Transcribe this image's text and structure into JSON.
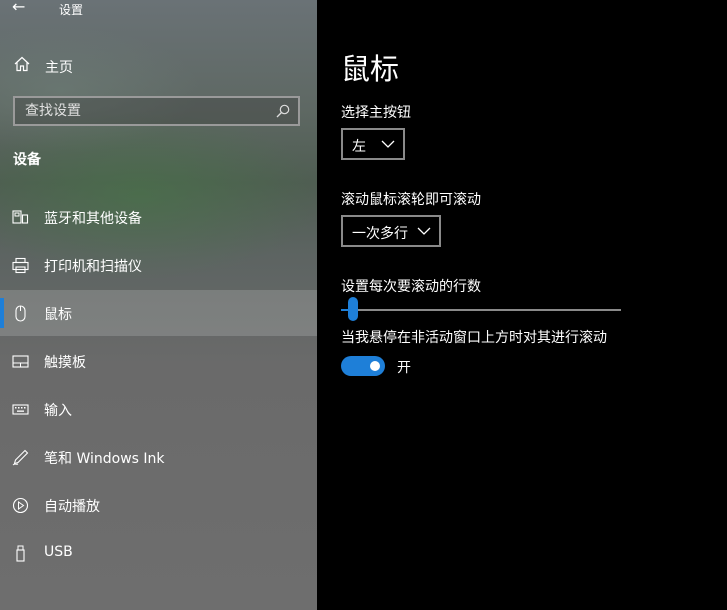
{
  "window": {
    "title": "设置",
    "back_icon": "back-arrow-icon"
  },
  "sidebar": {
    "home": {
      "label": "主页",
      "icon": "home-icon"
    },
    "search": {
      "placeholder": "查找设置",
      "value": "",
      "icon": "search-icon"
    },
    "section_title": "设备",
    "items": [
      {
        "label": "蓝牙和其他设备",
        "icon": "bluetooth-devices-icon",
        "active": false
      },
      {
        "label": "打印机和扫描仪",
        "icon": "printer-icon",
        "active": false
      },
      {
        "label": "鼠标",
        "icon": "mouse-icon",
        "active": true
      },
      {
        "label": "触摸板",
        "icon": "touchpad-icon",
        "active": false
      },
      {
        "label": "输入",
        "icon": "keyboard-icon",
        "active": false
      },
      {
        "label": "笔和 Windows Ink",
        "icon": "pen-icon",
        "active": false
      },
      {
        "label": "自动播放",
        "icon": "autoplay-icon",
        "active": false
      },
      {
        "label": "USB",
        "icon": "usb-icon",
        "active": false
      }
    ]
  },
  "main": {
    "title": "鼠标",
    "primary_button": {
      "label": "选择主按钮",
      "value": "左"
    },
    "scroll_mode": {
      "label": "滚动鼠标滚轮即可滚动",
      "value": "一次多行"
    },
    "scroll_lines": {
      "label": "设置每次要滚动的行数",
      "value_fraction": 0.01
    },
    "inactive_scroll": {
      "label": "当我悬停在非活动窗口上方时对其进行滚动",
      "state_label": "开",
      "on": true
    }
  },
  "colors": {
    "accent": "#1e7fd8",
    "main_bg": "#000000",
    "text": "#ffffff"
  }
}
